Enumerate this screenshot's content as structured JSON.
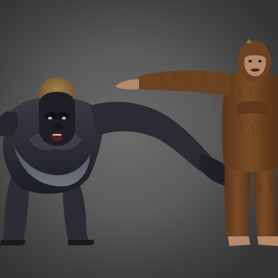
{
  "scene": {
    "background_color": "#565656",
    "models": [
      {
        "name": "gorilla-model",
        "fur_color": "#2a2b33",
        "crest_color": "#8a6a40",
        "pose": "quadruped-stance"
      },
      {
        "name": "bigfoot-model",
        "fur_color": "#6b4320",
        "face_color": "#b48a6a",
        "pose": "t-pose"
      }
    ]
  }
}
